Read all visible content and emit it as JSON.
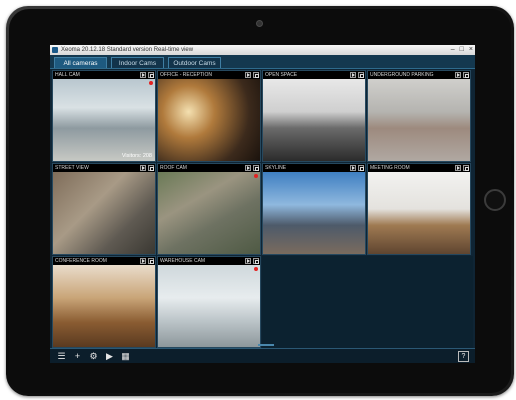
{
  "window": {
    "title": "Xeoma 20.12.18 Standard version Real-time view",
    "buttons": [
      "–",
      "□",
      "×"
    ]
  },
  "tabs": [
    {
      "label": "All cameras",
      "active": true
    },
    {
      "label": "Indoor Cams",
      "active": false
    },
    {
      "label": "Outdoor Cams",
      "active": false
    }
  ],
  "cameras": [
    {
      "label": "HALL CAM",
      "overlay": "Visitors: 208",
      "recording": true,
      "scene": "hall"
    },
    {
      "label": "OFFICE - RECEPTION",
      "overlay": "",
      "recording": false,
      "scene": "office"
    },
    {
      "label": "OPEN SPACE",
      "overlay": "",
      "recording": false,
      "scene": "openspace"
    },
    {
      "label": "UNDERGROUND PARKING",
      "overlay": "",
      "recording": false,
      "scene": "parking"
    },
    {
      "label": "STREET VIEW",
      "overlay": "",
      "recording": false,
      "scene": "street"
    },
    {
      "label": "ROOF CAM",
      "overlay": "",
      "recording": true,
      "scene": "aerial"
    },
    {
      "label": "SKYLINE",
      "overlay": "",
      "recording": false,
      "scene": "skyline"
    },
    {
      "label": "MEETING ROOM",
      "overlay": "",
      "recording": false,
      "scene": "meeting"
    },
    {
      "label": "CONFERENCE ROOM",
      "overlay": "",
      "recording": false,
      "scene": "conference"
    },
    {
      "label": "WAREHOUSE CAM",
      "overlay": "",
      "recording": true,
      "scene": "warehouse"
    }
  ],
  "toolbar": {
    "icons": [
      "list-icon",
      "plus-icon",
      "gear-icon",
      "play-icon",
      "layout-icon"
    ],
    "help_label": "?"
  },
  "colors": {
    "background": "#0f2535",
    "tab_active": "#1e5a80",
    "recording": "#e32222"
  }
}
